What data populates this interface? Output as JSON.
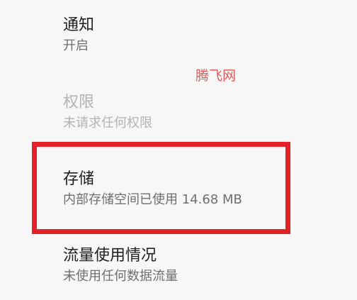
{
  "settings": {
    "notification": {
      "title": "通知",
      "summary": "开启"
    },
    "permissions": {
      "title": "权限",
      "summary": "未请求任何权限"
    },
    "storage": {
      "title": "存储",
      "summary": "内部存储空间已使用 14.68 MB"
    },
    "data_usage": {
      "title": "流量使用情况",
      "summary": "未使用任何数据流量"
    }
  },
  "watermark": {
    "text": "腾飞网"
  },
  "colors": {
    "background": "#f7f7f7",
    "title_text": "#1f1f1f",
    "summary_text": "#6f6f6f",
    "disabled_text": "#b3b3b3",
    "highlight_border": "#e32129",
    "watermark": "#e05a5a"
  }
}
